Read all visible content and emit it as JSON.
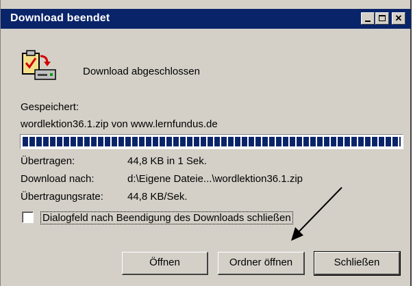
{
  "window": {
    "title": "Download beendet",
    "controls": [
      "minimize",
      "maximize",
      "close"
    ]
  },
  "header": {
    "icon": "download-complete-icon",
    "message": "Download abgeschlossen"
  },
  "saved": {
    "label": "Gespeichert:",
    "file": "wordlektion36.1.zip von www.lernfundus.de"
  },
  "progress": {
    "fraction": 1.0
  },
  "details": {
    "transferred_label": "Übertragen:",
    "transferred_value": "44,8 KB in 1 Sek.",
    "download_to_label": "Download nach:",
    "download_to_value": "d:\\Eigene Dateie...\\wordlektion36.1.zip",
    "rate_label": "Übertragungsrate:",
    "rate_value": "44,8 KB/Sek."
  },
  "checkbox": {
    "label": "Dialogfeld nach Beendigung des Downloads schließen",
    "checked": false
  },
  "buttons": {
    "open": "Öffnen",
    "open_folder": "Ordner öffnen",
    "close": "Schließen"
  },
  "colors": {
    "titlebar": "#0a246a",
    "dialog_bg": "#d4d0c8",
    "progress": "#0a246a"
  }
}
